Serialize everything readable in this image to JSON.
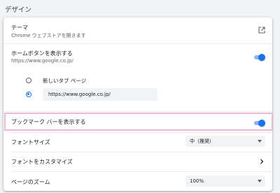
{
  "section": {
    "title": "デザイン"
  },
  "theme": {
    "label": "テーマ",
    "sublabel": "Chrome ウェブストアを開きます",
    "icon": "open-in-new-icon"
  },
  "home_button": {
    "label": "ホームボタンを表示する",
    "sublabel": "https://www.google.co.jp/",
    "toggle_on": true,
    "options": [
      {
        "label": "新しいタブ ページ",
        "selected": false
      },
      {
        "value": "https://www.google.co.jp/",
        "selected": true
      }
    ]
  },
  "bookmarks_bar": {
    "label": "ブックマーク バーを表示する",
    "toggle_on": true
  },
  "font_size": {
    "label": "フォントサイズ",
    "value": "中（推奨）"
  },
  "customize_fonts": {
    "label": "フォントをカスタマイズ",
    "icon": "chevron-right-icon"
  },
  "page_zoom": {
    "label": "ページのズーム",
    "value": "100%"
  },
  "colors": {
    "accent": "#1a73e8",
    "toggle_track": "#8ab4f8",
    "highlight": "#ebb8d4"
  }
}
